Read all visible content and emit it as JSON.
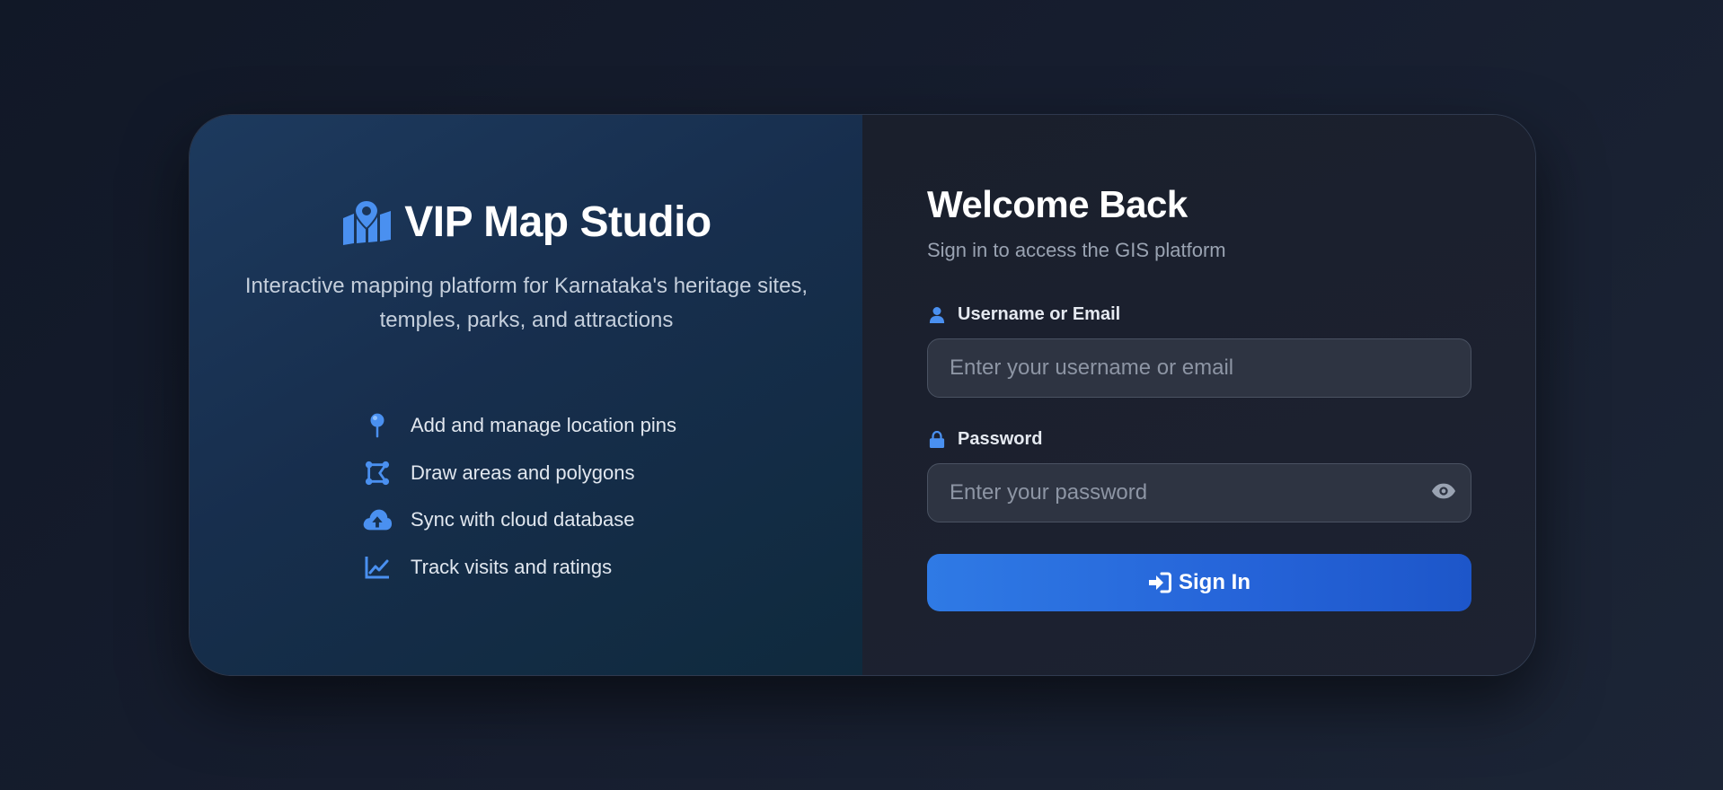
{
  "brand": {
    "icon": "map-location-icon",
    "title": "VIP Map Studio",
    "tagline": "Interactive mapping platform for Karnataka's heritage sites, temples, parks, and attractions"
  },
  "features": [
    {
      "icon": "map-pin-icon",
      "label": "Add and manage location pins"
    },
    {
      "icon": "polygon-icon",
      "label": "Draw areas and polygons"
    },
    {
      "icon": "cloud-upload-icon",
      "label": "Sync with cloud database"
    },
    {
      "icon": "line-chart-icon",
      "label": "Track visits and ratings"
    }
  ],
  "login": {
    "title": "Welcome Back",
    "subtitle": "Sign in to access the GIS platform",
    "username": {
      "icon": "user-icon",
      "label": "Username or Email",
      "placeholder": "Enter your username or email",
      "value": ""
    },
    "password": {
      "icon": "lock-icon",
      "label": "Password",
      "placeholder": "Enter your password",
      "value": "",
      "toggle_icon": "eye-icon"
    },
    "submit": {
      "icon": "sign-in-icon",
      "label": "Sign In"
    }
  },
  "colors": {
    "accent": "#3b82f6",
    "button": "#2563d8",
    "background": "#111827",
    "panel_left": "#1d3a5e",
    "panel_right": "#1a1f2c"
  }
}
